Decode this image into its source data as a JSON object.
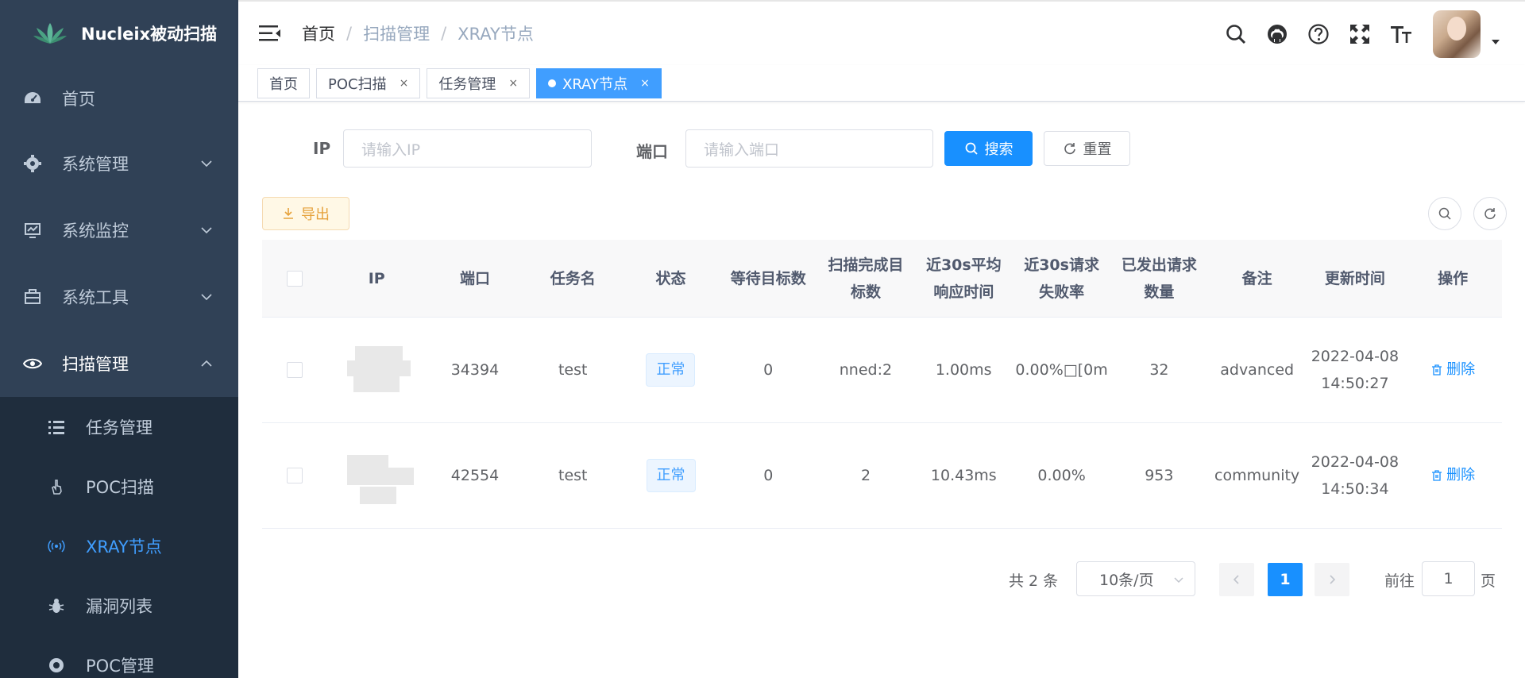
{
  "app": {
    "title": "Nucleix被动扫描"
  },
  "sidebar": {
    "items": [
      {
        "label": "首页",
        "icon": "dashboard-icon"
      },
      {
        "label": "系统管理",
        "icon": "gear-icon"
      },
      {
        "label": "系统监控",
        "icon": "monitor-icon"
      },
      {
        "label": "系统工具",
        "icon": "toolbox-icon"
      },
      {
        "label": "扫描管理",
        "icon": "eye-icon"
      }
    ],
    "subitems": [
      {
        "label": "任务管理",
        "icon": "list-icon"
      },
      {
        "label": "POC扫描",
        "icon": "hand-icon"
      },
      {
        "label": "XRAY节点",
        "icon": "radio-icon",
        "active": true
      },
      {
        "label": "漏洞列表",
        "icon": "bug-icon"
      },
      {
        "label": "POC管理",
        "icon": "lifebuoy-icon"
      }
    ]
  },
  "breadcrumb": {
    "items": [
      "首页",
      "扫描管理",
      "XRAY节点"
    ]
  },
  "tags": [
    {
      "label": "首页"
    },
    {
      "label": "POC扫描"
    },
    {
      "label": "任务管理"
    },
    {
      "label": "XRAY节点",
      "active": true
    }
  ],
  "search": {
    "ip_label": "IP",
    "ip_placeholder": "请输入IP",
    "port_label": "端口",
    "port_placeholder": "请输入端口",
    "search_label": "搜索",
    "reset_label": "重置"
  },
  "toolbar": {
    "export_label": "导出"
  },
  "table": {
    "headers": {
      "ip": "IP",
      "port": "端口",
      "task": "任务名",
      "status": "状态",
      "wait": "等待目标数",
      "done": "扫描完成目标数",
      "rt": "近30s平均响应时间",
      "fail": "近30s请求失败率",
      "sent": "已发出请求数量",
      "note": "备注",
      "time": "更新时间",
      "op": "操作"
    },
    "rows": [
      {
        "port": "34394",
        "task": "test",
        "status": "正常",
        "wait": "0",
        "done": "nned:2",
        "rt": "1.00ms",
        "fail": "0.00%□[0m",
        "sent": "32",
        "note": "advanced",
        "time": "2022-04-08 14:50:27",
        "op": "删除"
      },
      {
        "port": "42554",
        "task": "test",
        "status": "正常",
        "wait": "0",
        "done": "2",
        "rt": "10.43ms",
        "fail": "0.00%",
        "sent": "953",
        "note": "community",
        "time": "2022-04-08 14:50:34",
        "op": "删除"
      }
    ]
  },
  "pagination": {
    "total": "共 2 条",
    "page_size": "10条/页",
    "current": "1",
    "goto_prefix": "前往",
    "goto_value": "1",
    "goto_suffix": "页"
  },
  "colors": {
    "sidebar_bg": "#304156",
    "submenu_bg": "#1f2d3d",
    "accent": "#1890ff"
  }
}
